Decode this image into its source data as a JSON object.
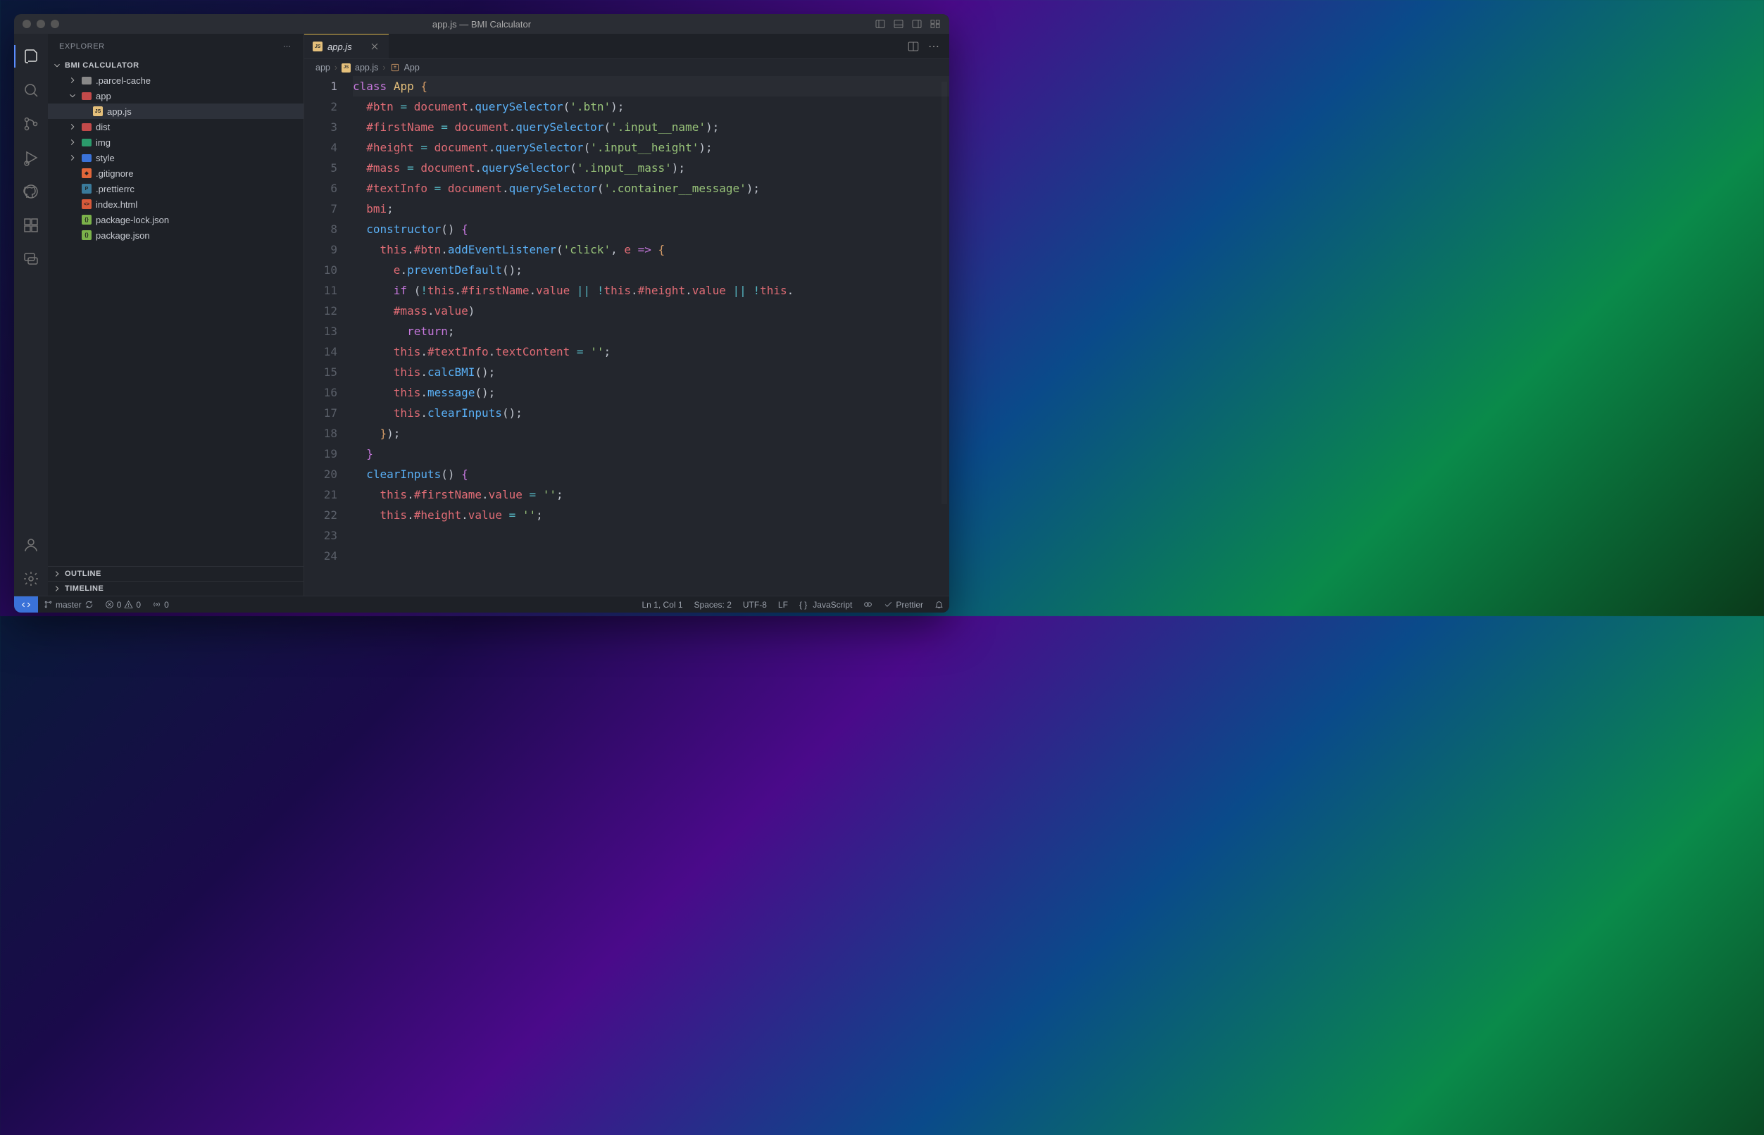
{
  "title": "app.js — BMI Calculator",
  "sidebar": {
    "header": "EXPLORER",
    "project": "BMI CALCULATOR",
    "outline": "OUTLINE",
    "timeline": "TIMELINE",
    "tree": [
      {
        "name": ".parcel-cache",
        "type": "folder",
        "depth": 1,
        "color": "#888"
      },
      {
        "name": "app",
        "type": "folder",
        "depth": 1,
        "open": true,
        "color": "#c24a4a"
      },
      {
        "name": "app.js",
        "type": "file",
        "depth": 2,
        "sel": true,
        "iconbg": "#e5c07b",
        "icontx": "JS"
      },
      {
        "name": "dist",
        "type": "folder",
        "depth": 1,
        "color": "#c24a4a"
      },
      {
        "name": "img",
        "type": "folder",
        "depth": 1,
        "color": "#2b9a6b"
      },
      {
        "name": "style",
        "type": "folder",
        "depth": 1,
        "color": "#3a72d8"
      },
      {
        "name": ".gitignore",
        "type": "file",
        "depth": 1,
        "iconbg": "#e0663a",
        "icontx": "◆"
      },
      {
        "name": ".prettierrc",
        "type": "file",
        "depth": 1,
        "iconbg": "#3a7a9a",
        "icontx": "P"
      },
      {
        "name": "index.html",
        "type": "file",
        "depth": 1,
        "iconbg": "#d85a3a",
        "icontx": "<>"
      },
      {
        "name": "package-lock.json",
        "type": "file",
        "depth": 1,
        "iconbg": "#7bb24a",
        "icontx": "{}"
      },
      {
        "name": "package.json",
        "type": "file",
        "depth": 1,
        "iconbg": "#7bb24a",
        "icontx": "{}"
      }
    ]
  },
  "tab": {
    "label": "app.js",
    "iconbg": "#e5c07b",
    "icontx": "JS"
  },
  "breadcrumb": [
    "app",
    "app.js",
    "App"
  ],
  "code_lines": 24,
  "statusbar": {
    "branch": "master",
    "errors": "0",
    "warnings": "0",
    "radio": "0",
    "ln": "Ln 1, Col 1",
    "spaces": "Spaces: 2",
    "enc": "UTF-8",
    "eol": "LF",
    "lang": "JavaScript",
    "prettier": "Prettier"
  }
}
